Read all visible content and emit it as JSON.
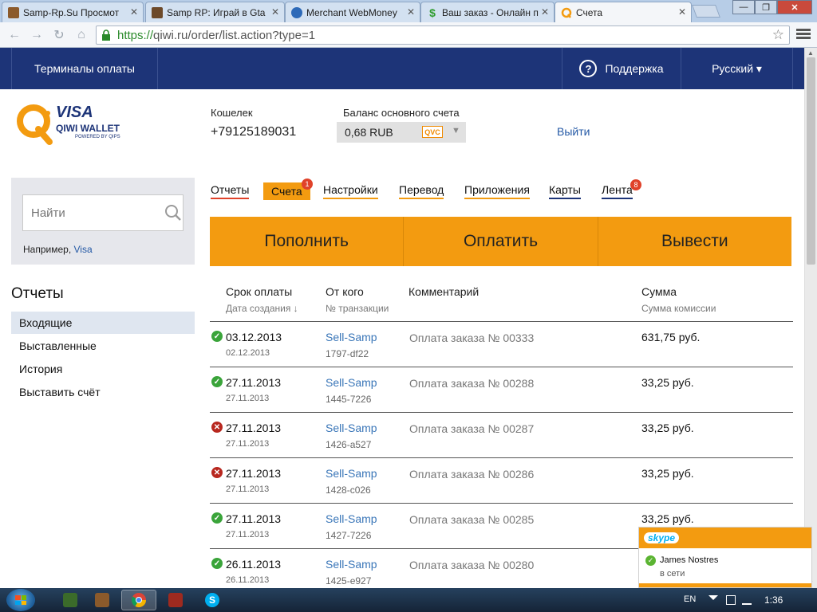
{
  "browser": {
    "tabs": [
      {
        "title": "Samp-Rp.Su Просмот",
        "favicon_color": "#8b5a2b"
      },
      {
        "title": "Samp RP: Играй в Gta",
        "favicon_color": "#6d4a2a"
      },
      {
        "title": "Merchant WebMoney",
        "favicon_color": "#2e6ab8"
      },
      {
        "title": "Ваш заказ - Онлайн п",
        "favicon_color": "#2e9c2e"
      },
      {
        "title": "Счета",
        "favicon_color": "#f39b10"
      }
    ],
    "url_proto": "https://",
    "url_rest": "qiwi.ru/order/list.action?type=1"
  },
  "header": {
    "terminals": "Терминалы оплаты",
    "support": "Поддержка",
    "language": "Русский ▾"
  },
  "logo": {
    "visa": "VISA",
    "wallet": "QIWI WALLET",
    "powered": "POWERED BY QIPS"
  },
  "account": {
    "wallet_label": "Кошелек",
    "wallet_number": "+79125189031",
    "balance_label": "Баланс основного счета",
    "balance_value": "0,68 RUB",
    "currency_badge": "QVC",
    "logout": "Выйти"
  },
  "search": {
    "placeholder": "Найти",
    "example_prefix": "Например, ",
    "example_link": "Visa"
  },
  "sidebar": {
    "title": "Отчеты",
    "items": [
      {
        "label": "Входящие",
        "selected": true
      },
      {
        "label": "Выставленные",
        "selected": false
      },
      {
        "label": "История",
        "selected": false
      },
      {
        "label": "Выставить счёт",
        "selected": false
      }
    ]
  },
  "tabs": [
    {
      "label": "Отчеты",
      "underline": "#e0422a"
    },
    {
      "label": "Счета",
      "badge": "1",
      "active": true
    },
    {
      "label": "Настройки",
      "underline": "#f39b10"
    },
    {
      "label": "Перевод",
      "underline": "#f39b10"
    },
    {
      "label": "Приложения",
      "underline": "#f39b10"
    },
    {
      "label": "Карты",
      "underline": "#1d3478"
    },
    {
      "label": "Лента",
      "badge": "8",
      "underline": "#1d3478"
    }
  ],
  "actions": [
    "Пополнить",
    "Оплатить",
    "Вывести"
  ],
  "table": {
    "headers": {
      "due": "Срок оплаты",
      "created": "Дата создания ↓",
      "from": "От кого",
      "txn": "№ транзакции",
      "comment": "Комментарий",
      "amount": "Сумма",
      "fee": "Сумма комиссии"
    },
    "rows": [
      {
        "status": "paid",
        "due": "03.12.2013",
        "created": "02.12.2013",
        "from": "Sell-Samp",
        "txn": "1797-df22",
        "comment": "Оплата заказа № 00333",
        "amount": "631,75 руб."
      },
      {
        "status": "paid",
        "due": "27.11.2013",
        "created": "27.11.2013",
        "from": "Sell-Samp",
        "txn": "1445-7226",
        "comment": "Оплата заказа № 00288",
        "amount": "33,25 руб."
      },
      {
        "status": "cancelled",
        "due": "27.11.2013",
        "created": "27.11.2013",
        "from": "Sell-Samp",
        "txn": "1426-a527",
        "comment": "Оплата заказа № 00287",
        "amount": "33,25 руб."
      },
      {
        "status": "cancelled",
        "due": "27.11.2013",
        "created": "27.11.2013",
        "from": "Sell-Samp",
        "txn": "1428-c026",
        "comment": "Оплата заказа № 00286",
        "amount": "33,25 руб."
      },
      {
        "status": "paid",
        "due": "27.11.2013",
        "created": "27.11.2013",
        "from": "Sell-Samp",
        "txn": "1427-7226",
        "comment": "Оплата заказа № 00285",
        "amount": "33,25 руб."
      },
      {
        "status": "paid",
        "due": "26.11.2013",
        "created": "26.11.2013",
        "from": "Sell-Samp",
        "txn": "1425-e927",
        "comment": "Оплата заказа № 00280",
        "amount": ""
      }
    ]
  },
  "skype": {
    "brand": "skype",
    "contact": "James Nostres",
    "status": "в сети"
  },
  "taskbar": {
    "lang": "EN",
    "time": "1:36"
  },
  "colors": {
    "qiwi_orange": "#f39b10",
    "qiwi_navy": "#1d3478",
    "link_blue": "#3a76b8"
  }
}
